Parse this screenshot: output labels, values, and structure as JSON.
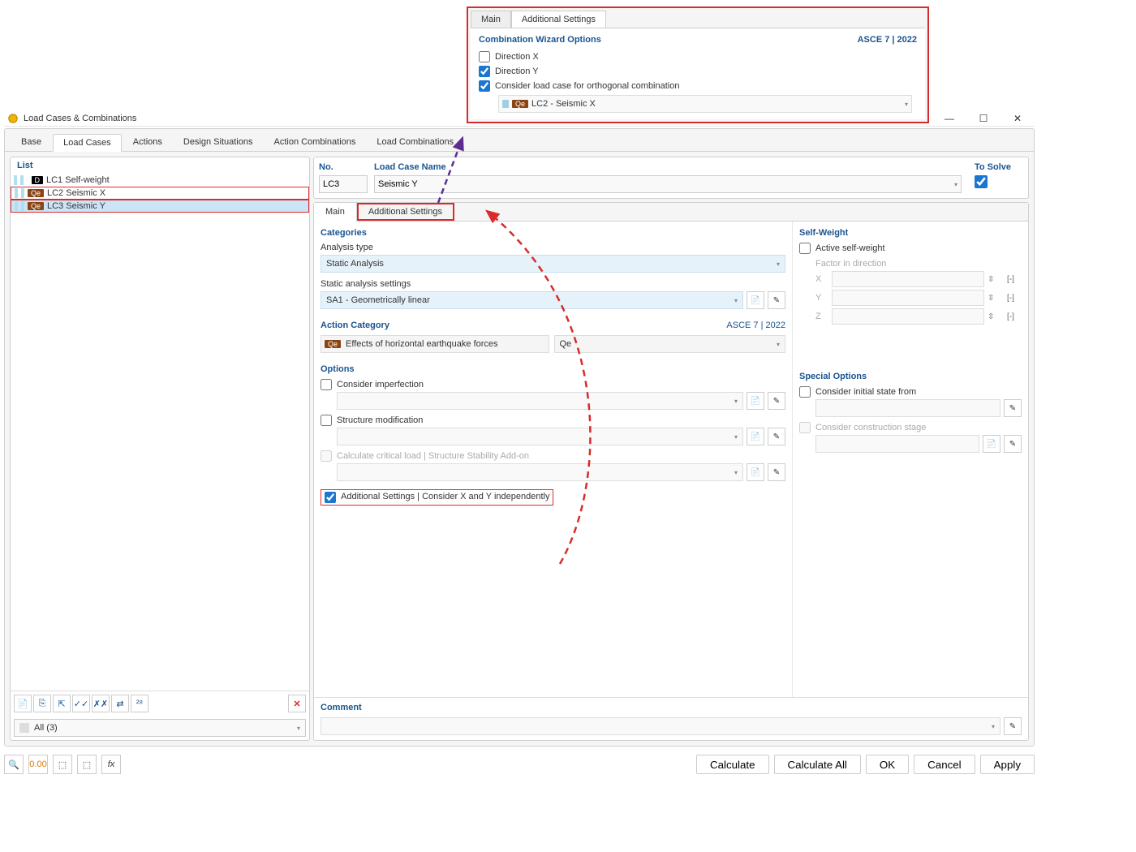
{
  "window": {
    "title": "Load Cases & Combinations"
  },
  "popup": {
    "tabs": {
      "main": "Main",
      "additional": "Additional Settings"
    },
    "header": "Combination Wizard Options",
    "standard": "ASCE 7 | 2022",
    "dir_x": "Direction X",
    "dir_y": "Direction Y",
    "consider_ortho": "Consider load case for orthogonal combination",
    "orth_badge": "Qe",
    "orth_value": "LC2 - Seismic X"
  },
  "top_tabs": {
    "base": "Base",
    "load_cases": "Load Cases",
    "actions": "Actions",
    "design": "Design Situations",
    "action_combos": "Action Combinations",
    "load_combos": "Load Combinations"
  },
  "list": {
    "header": "List",
    "rows": [
      {
        "badge": "D",
        "badge_class": "d",
        "name": "LC1  Self-weight",
        "selected": false,
        "hl": false
      },
      {
        "badge": "Qe",
        "badge_class": "qe",
        "name": "LC2  Seismic X",
        "selected": false,
        "hl": true
      },
      {
        "badge": "Qe",
        "badge_class": "qe",
        "name": "LC3  Seismic Y",
        "selected": true,
        "hl": true
      }
    ],
    "filter": "All (3)"
  },
  "details": {
    "no_lbl": "No.",
    "no_val": "LC3",
    "name_lbl": "Load Case Name",
    "name_val": "Seismic Y",
    "solve_lbl": "To Solve",
    "tabs": {
      "main": "Main",
      "additional": "Additional Settings"
    },
    "categories_h": "Categories",
    "analysis_type_lbl": "Analysis type",
    "analysis_type_val": "Static Analysis",
    "static_settings_lbl": "Static analysis settings",
    "static_settings_val": "SA1 - Geometrically linear",
    "action_cat_h": "Action Category",
    "asce": "ASCE 7 | 2022",
    "ac_badge": "Qe",
    "ac_name": "Effects of horizontal earthquake forces",
    "ac_code": "Qe",
    "options_h": "Options",
    "opts": {
      "imperfection": "Consider imperfection",
      "structure_mod": "Structure modification",
      "crit_load": "Calculate critical load | Structure Stability Add-on",
      "additional": "Additional Settings | Consider X and Y independently"
    },
    "selfweight_h": "Self-Weight",
    "active_sw": "Active self-weight",
    "factor_dir": "Factor in direction",
    "axes": {
      "x": "X",
      "y": "Y",
      "z": "Z"
    },
    "unit": "[-]",
    "special_h": "Special Options",
    "special": {
      "initial": "Consider initial state from",
      "constr": "Consider construction stage"
    },
    "comment_h": "Comment"
  },
  "footer": {
    "calculate": "Calculate",
    "calculate_all": "Calculate All",
    "ok": "OK",
    "cancel": "Cancel",
    "apply": "Apply"
  }
}
